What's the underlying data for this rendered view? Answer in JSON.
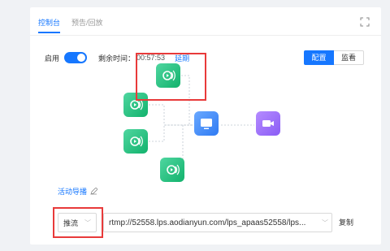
{
  "tabs": [
    "控制台",
    "预告/回放"
  ],
  "controls": {
    "enable_label": "启用",
    "remaining_label": "剩余时间：",
    "timer": "00:57:53",
    "extend_label": "延期"
  },
  "view_modes": [
    "配置",
    "监看"
  ],
  "guide_label": "活动导播",
  "push": {
    "mode": "推流",
    "url": "rtmp://52558.lps.aodianyun.com/lps_apaas52558/lps..."
  },
  "copy_label": "复制",
  "colors": {
    "accent": "#1677ff",
    "highlight": "#e83a3a",
    "source_node": "#12b26c",
    "mixer_node": "#2f7bf3",
    "output_node": "#8a5cf5"
  },
  "icons": [
    "expand-icon",
    "live-source-icon",
    "monitor-icon",
    "video-output-icon",
    "edit-icon",
    "chevron-down-icon"
  ]
}
